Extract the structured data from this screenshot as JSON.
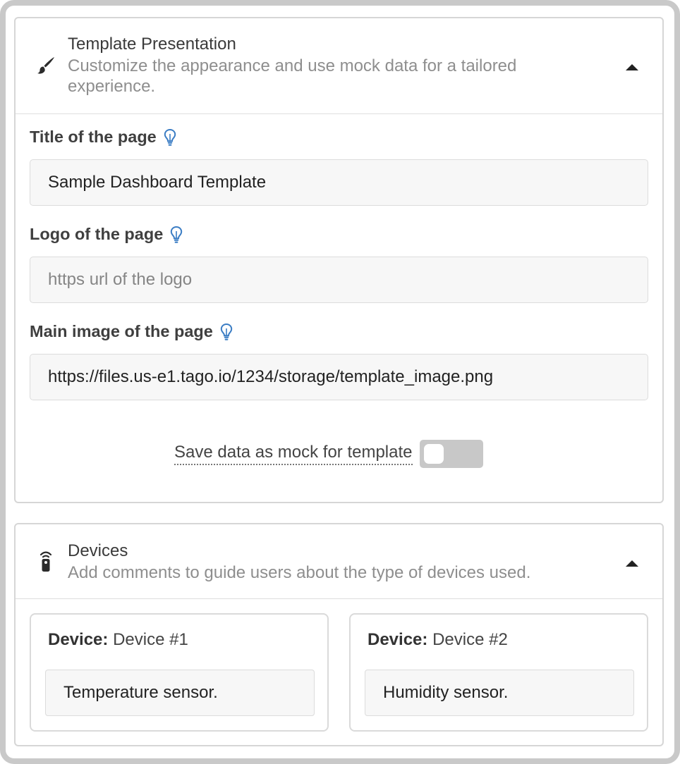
{
  "template_presentation": {
    "title": "Template Presentation",
    "description": "Customize the appearance and use mock data for a tailored experience.",
    "icon": "paint-brush-icon",
    "fields": [
      {
        "label": "Title of the page",
        "value": "Sample Dashboard Template",
        "placeholder": ""
      },
      {
        "label": "Logo of the page",
        "value": "",
        "placeholder": "https url of the logo"
      },
      {
        "label": "Main image of the page",
        "value": "https://files.us-e1.tago.io/1234/storage/template_image.png",
        "placeholder": ""
      }
    ],
    "mock_toggle": {
      "label": "Save data as mock for template",
      "enabled": false
    }
  },
  "devices": {
    "title": "Devices",
    "description": "Add comments to guide users about the type of devices used.",
    "icon": "remote-device-icon",
    "device_prefix": "Device:",
    "items": [
      {
        "name": "Device #1",
        "comment": "Temperature sensor."
      },
      {
        "name": "Device #2",
        "comment": "Humidity sensor."
      }
    ]
  },
  "colors": {
    "hint_icon": "#3b7dc4",
    "toggle_off": "#c8c8c8",
    "frame_border": "#c9c9c9"
  }
}
